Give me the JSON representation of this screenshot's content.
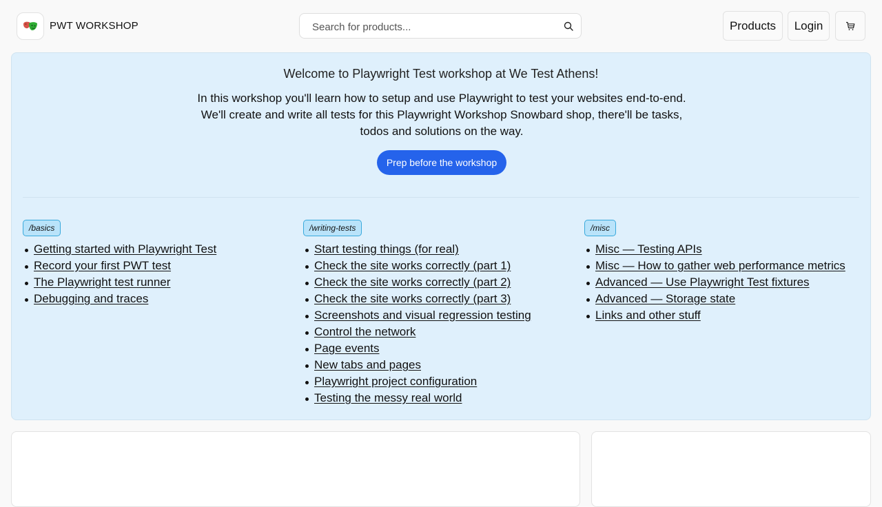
{
  "header": {
    "logo_icon": "playwright-masks-icon",
    "brand": "PWT WORKSHOP",
    "search": {
      "placeholder": "Search for products...",
      "value": "",
      "icon": "search-icon"
    },
    "nav": {
      "products": "Products",
      "login": "Login",
      "cart_icon": "cart-icon"
    }
  },
  "hero": {
    "title": "Welcome to Playwright Test workshop at We Test Athens!",
    "description": "In this workshop you'll learn how to setup and use Playwright to test your websites end-to-end. We'll create and write all tests for this Playwright Workshop Snowbard shop, there'll be tasks, todos and solutions on the way.",
    "cta": "Prep before the workshop",
    "columns": [
      {
        "tag": "/basics",
        "links": [
          "Getting started with Playwright Test",
          "Record your first PWT test",
          "The Playwright test runner",
          "Debugging and traces"
        ]
      },
      {
        "tag": "/writing-tests",
        "links": [
          "Start testing things (for real)",
          "Check the site works correctly (part 1)",
          "Check the site works correctly (part 2)",
          "Check the site works correctly (part 3)",
          "Screenshots and visual regression testing",
          "Control the network",
          "Page events",
          "New tabs and pages",
          "Playwright project configuration",
          "Testing the messy real world"
        ]
      },
      {
        "tag": "/misc",
        "links": [
          "Misc — Testing APIs",
          "Misc — How to gather web performance metrics",
          "Advanced — Use Playwright Test fixtures",
          "Advanced — Storage state",
          "Links and other stuff"
        ]
      }
    ]
  },
  "colors": {
    "hero_bg": "#dff0fc",
    "tag_bg": "#b9e3fa",
    "tag_border": "#38a9dc",
    "cta_bg": "#2563eb",
    "page_bg": "#f9f9f9"
  }
}
